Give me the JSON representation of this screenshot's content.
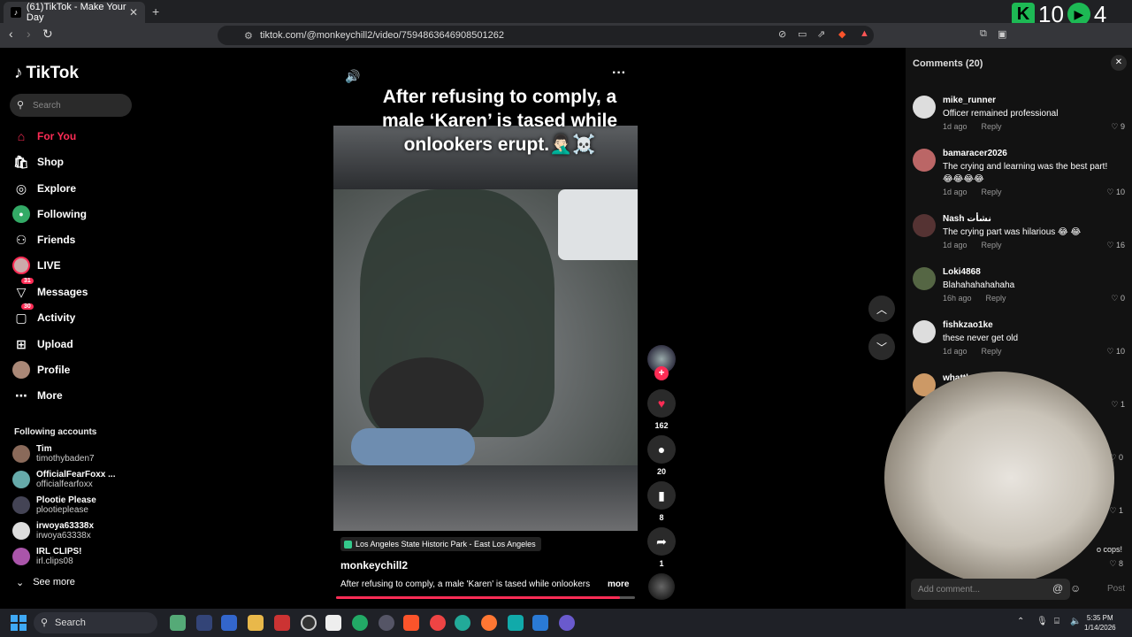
{
  "browser": {
    "tab_title": "(61)TikTok - Make Your Day",
    "tab_close": "✕",
    "new_tab": "+",
    "url": "tiktok.com/@monkeychill2/video/7594863646908501262",
    "overlay_score_1": "10",
    "overlay_score_2": "4"
  },
  "sidebar": {
    "logo": "TikTok",
    "search_placeholder": "Search",
    "nav": [
      {
        "label": "For You",
        "icon": "home-icon"
      },
      {
        "label": "Shop",
        "icon": "shop-icon"
      },
      {
        "label": "Explore",
        "icon": "compass-icon"
      },
      {
        "label": "Following",
        "icon": "following-icon"
      },
      {
        "label": "Friends",
        "icon": "friends-icon"
      },
      {
        "label": "LIVE",
        "icon": "live-icon"
      },
      {
        "label": "Messages",
        "icon": "messages-icon",
        "badge": "31"
      },
      {
        "label": "Activity",
        "icon": "activity-icon",
        "badge": "30"
      },
      {
        "label": "Upload",
        "icon": "upload-icon"
      },
      {
        "label": "Profile",
        "icon": "profile-icon"
      },
      {
        "label": "More",
        "icon": "more-icon"
      }
    ],
    "following_header": "Following accounts",
    "following": [
      {
        "name": "Tim",
        "handle": "timothybaden7"
      },
      {
        "name": "OfficialFearFoxx ...",
        "handle": "officialfearfoxx"
      },
      {
        "name": "Plootie Please",
        "handle": "plootieplease"
      },
      {
        "name": "irwoya63338x",
        "handle": "irwoya63338x"
      },
      {
        "name": "IRL CLIPS!",
        "handle": "irl.clips08"
      }
    ],
    "see_more": "See more"
  },
  "video": {
    "caption_overlay": "After refusing to comply, a male ‘Karen’ is tased while onlookers erupt.🤦🏻‍♂️☠️",
    "location": "Los Angeles State Historic Park - East Los Angeles",
    "author": "monkeychill2",
    "description": "After refusing to comply, a male 'Karen' is tased while onlookers",
    "more": "more",
    "progress": 0.95,
    "likes": "162",
    "comments": "20",
    "saves": "8",
    "shares": "1",
    "accent": "#fe2c55"
  },
  "comments": {
    "title": "Comments  (20)",
    "reply_label": "Reply",
    "items": [
      {
        "user": "mike_runner",
        "text": "Officer remained professional",
        "time": "1d ago",
        "likes": "9"
      },
      {
        "user": "bamaracer2026",
        "text": "The crying and learning was the best part! 😂😂😂😂",
        "time": "1d ago",
        "likes": "10"
      },
      {
        "user": "Nash نشأت",
        "text": "The crying part was hilarious 😂 😂",
        "time": "1d ago",
        "likes": "16"
      },
      {
        "user": "Loki4868",
        "text": "Blahahahahahaha",
        "time": "16h ago",
        "likes": "0"
      },
      {
        "user": "fishkzao1ke",
        "text": "these never get old",
        "time": "1d ago",
        "likes": "10"
      },
      {
        "user": "whatthahali",
        "text": "instant remo",
        "time": "",
        "likes": "1"
      }
    ],
    "extra_likes": [
      "0",
      "1",
      "8"
    ],
    "partial_text": "o cops!",
    "input_placeholder": "Add comment...",
    "post_label": "Post"
  },
  "taskbar": {
    "search": "Search",
    "time": "5:35 PM",
    "date": "1/14/2026"
  }
}
